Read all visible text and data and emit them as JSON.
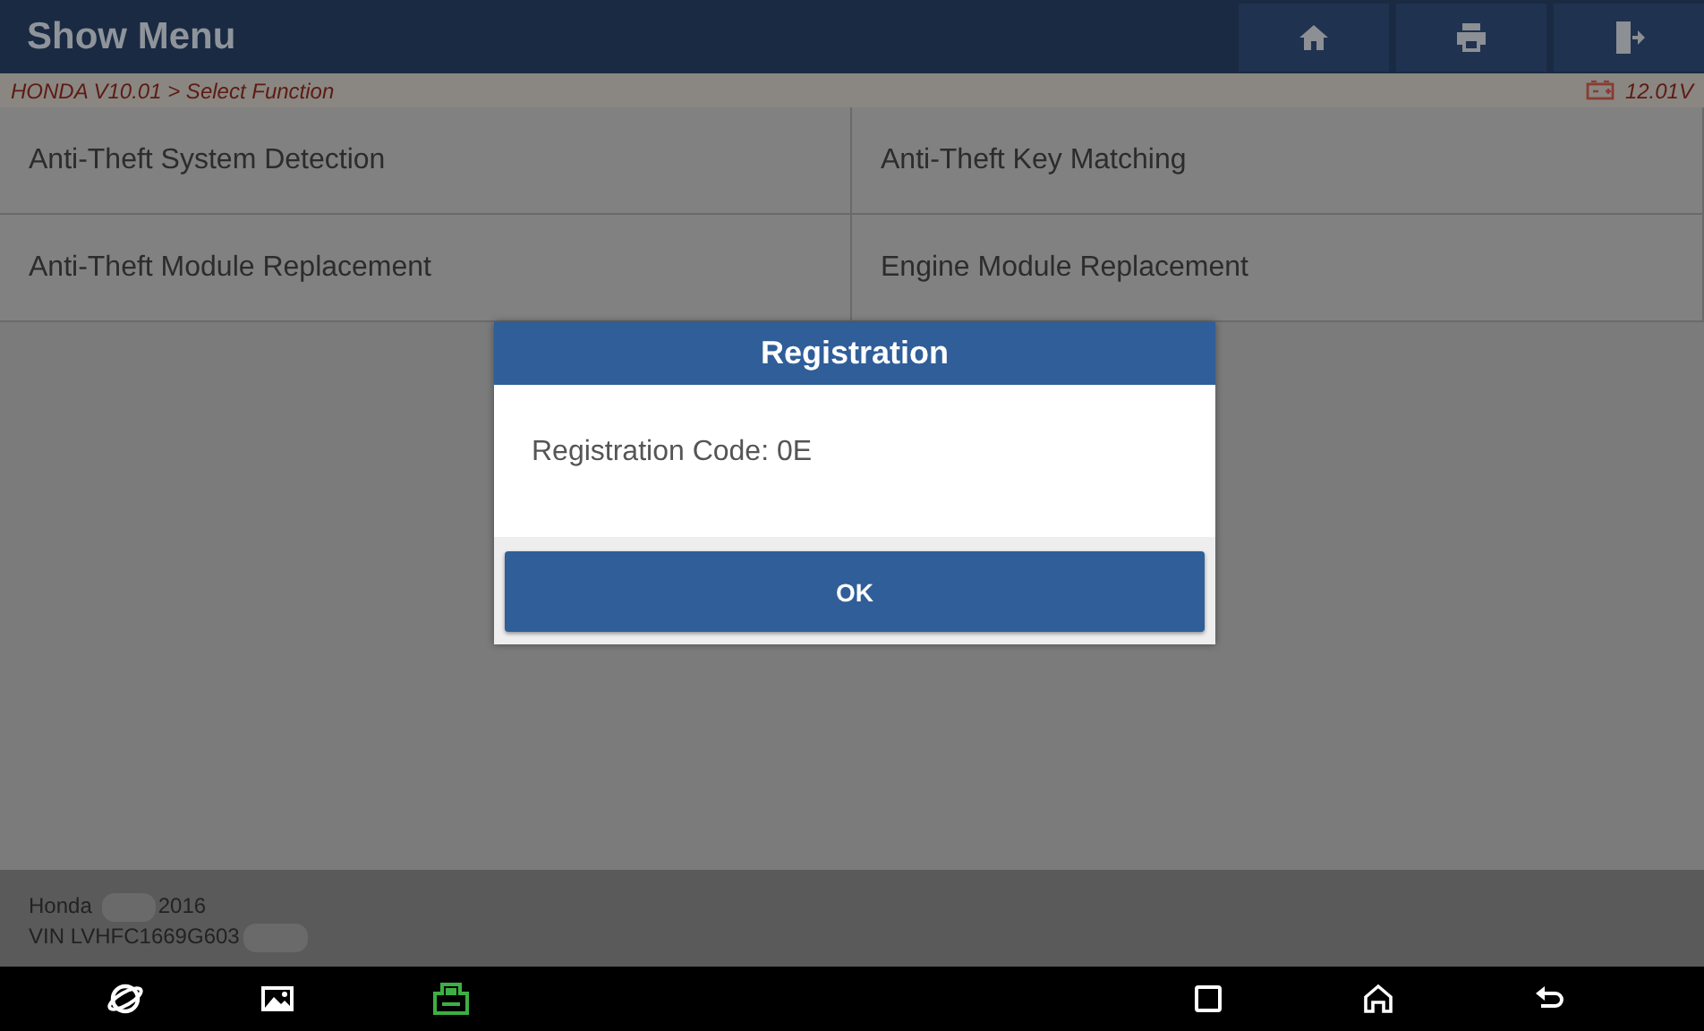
{
  "header": {
    "title": "Show Menu",
    "buttons": [
      {
        "kind": "home"
      },
      {
        "kind": "print"
      },
      {
        "kind": "exit"
      }
    ]
  },
  "breadcrumb": {
    "path": "HONDA V10.01 > Select Function",
    "voltage": "12.01V"
  },
  "menu_items": [
    {
      "label": "Anti-Theft System Detection"
    },
    {
      "label": "Anti-Theft Key Matching"
    },
    {
      "label": "Anti-Theft Module Replacement"
    },
    {
      "label": "Engine Module Replacement"
    }
  ],
  "vehicle": {
    "make": "Honda",
    "year": "2016",
    "vin": "VIN LVHFC1669G603"
  },
  "dialog": {
    "title": "Registration",
    "message": "Registration Code: 0E",
    "button": "OK"
  },
  "nav_bar": [
    {
      "kind": "browser"
    },
    {
      "kind": "gallery"
    },
    {
      "kind": "vci"
    },
    {
      "kind": "recents"
    },
    {
      "kind": "home"
    },
    {
      "kind": "back"
    }
  ]
}
